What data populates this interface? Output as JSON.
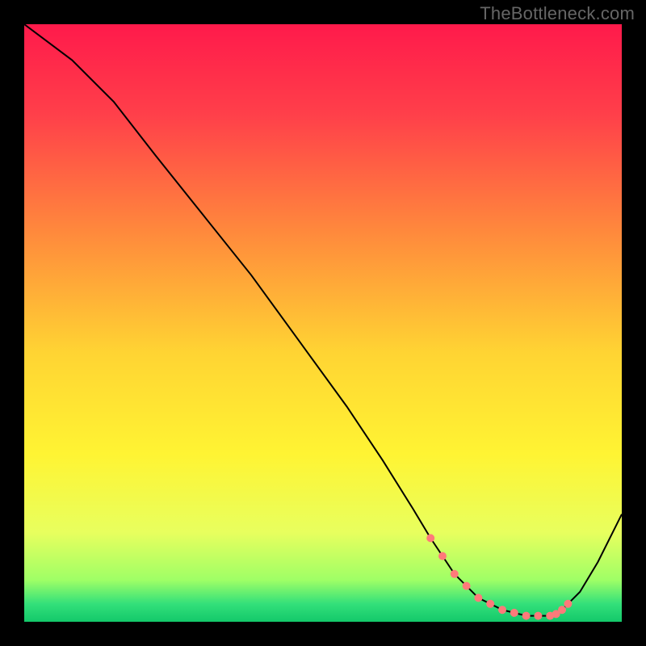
{
  "watermark": "TheBottleneck.com",
  "chart_data": {
    "type": "line",
    "title": "",
    "xlabel": "",
    "ylabel": "",
    "xlim": [
      0,
      100
    ],
    "ylim": [
      0,
      100
    ],
    "series": [
      {
        "name": "curve",
        "x": [
          0,
          8,
          15,
          22,
          30,
          38,
          46,
          54,
          60,
          65,
          68,
          72,
          76,
          80,
          84,
          88,
          90,
          93,
          96,
          100
        ],
        "y": [
          100,
          94,
          87,
          78,
          68,
          58,
          47,
          36,
          27,
          19,
          14,
          8,
          4,
          2,
          1,
          1,
          2,
          5,
          10,
          18
        ]
      }
    ],
    "markers": {
      "name": "dotted-segment",
      "x": [
        68,
        70,
        72,
        74,
        76,
        78,
        80,
        82,
        84,
        86,
        88,
        89,
        90,
        91
      ],
      "y": [
        14,
        11,
        8,
        6,
        4,
        3,
        2,
        1.5,
        1,
        1,
        1,
        1.3,
        2,
        3
      ]
    },
    "gradient_stops": [
      {
        "offset": 0.0,
        "color": "#ff1a4b"
      },
      {
        "offset": 0.15,
        "color": "#ff3f4a"
      },
      {
        "offset": 0.35,
        "color": "#ff8a3c"
      },
      {
        "offset": 0.55,
        "color": "#ffd433"
      },
      {
        "offset": 0.72,
        "color": "#fff433"
      },
      {
        "offset": 0.85,
        "color": "#e8ff5e"
      },
      {
        "offset": 0.93,
        "color": "#9fff66"
      },
      {
        "offset": 0.97,
        "color": "#33e07a"
      },
      {
        "offset": 1.0,
        "color": "#13c86a"
      }
    ],
    "marker_color": "#ff7a7a",
    "line_color": "#000000"
  }
}
